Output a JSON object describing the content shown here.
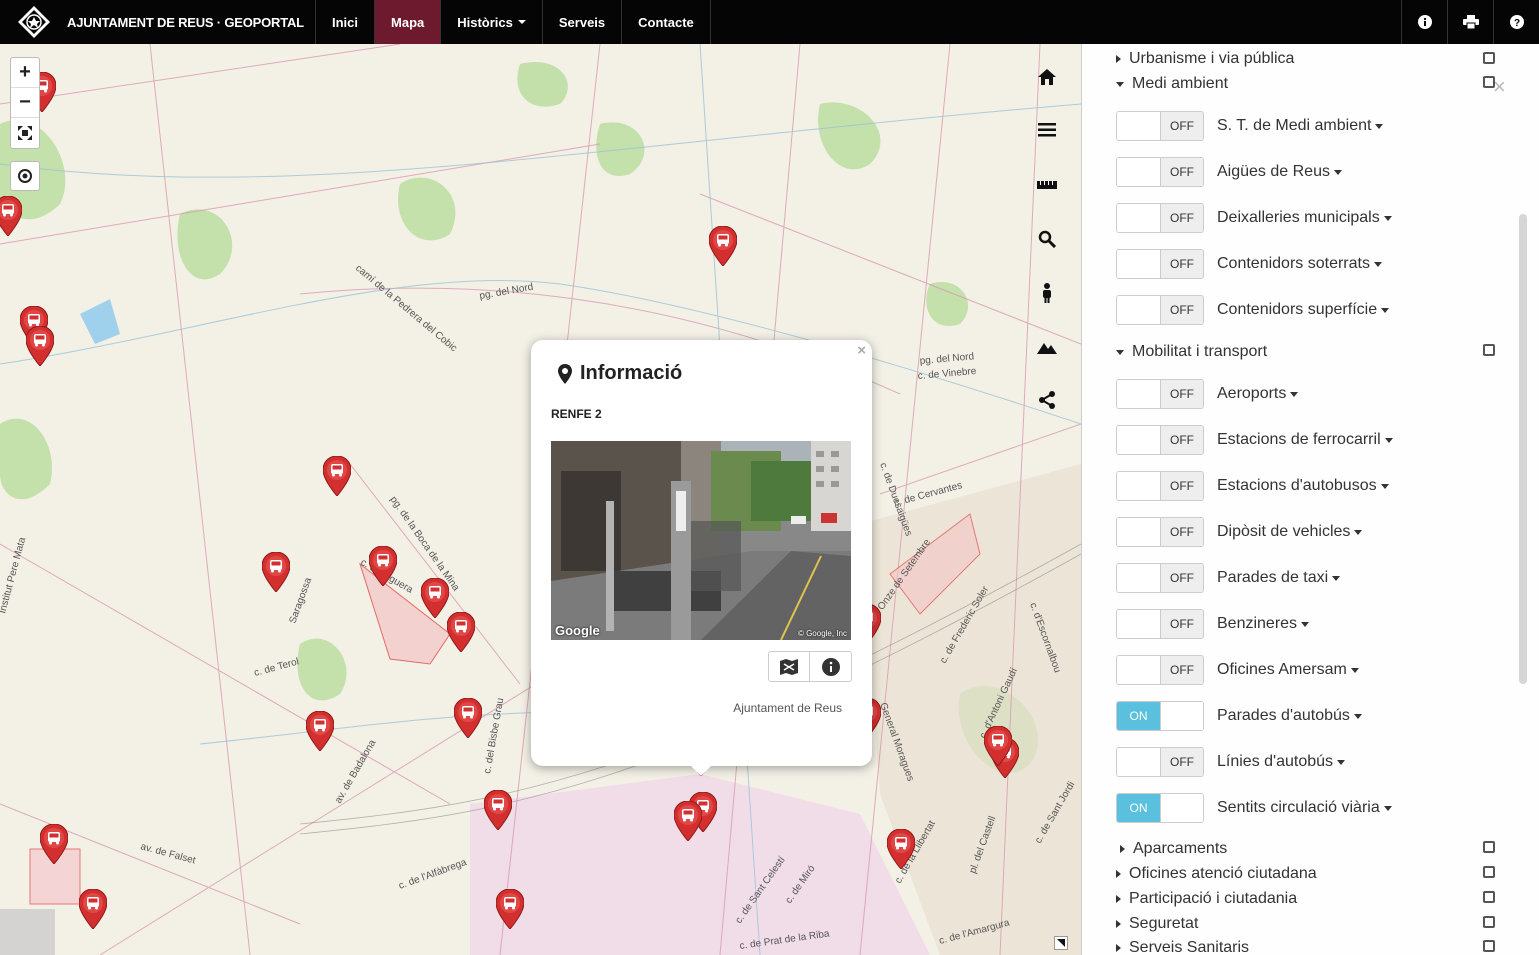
{
  "navbar": {
    "brand": "AJUNTAMENT DE REUS · GEOPORTAL",
    "items": [
      {
        "label": "Inici",
        "active": false
      },
      {
        "label": "Mapa",
        "active": true
      },
      {
        "label": "Històrics",
        "dropdown": true
      },
      {
        "label": "Serveis"
      },
      {
        "label": "Contacte"
      }
    ],
    "right_icons": [
      "info-icon",
      "print-icon",
      "help-icon"
    ]
  },
  "map": {
    "zoom_in": "+",
    "zoom_out": "−",
    "street_labels": [
      "pg. del Nord",
      "camí de la Pedrera del Cobic",
      "pg. de la Boca de la Mina",
      "c. de Figuera",
      "c. de Terol",
      "av. de Badalona",
      "c. del Bisbe Grau",
      "av. de Falset",
      "c. de l'Alfàbrega",
      "c. de Cervantes",
      "l'Onze de Setembre",
      "c. de Frederic Soler",
      "c. d'Antoni Gaudí",
      "General Moragues",
      "c. de la Llibertat",
      "c. de Sant Celestí",
      "c. de Miró",
      "c. de Prat de la Riba",
      "c. de Vinebre",
      "pg. del Nord",
      "Institut Pere Mata",
      "Saragossa",
      "c. de Duesaigües",
      "c. de l'Amargura",
      "c. d'Escornalbou",
      "c. de Sant Jordi",
      "pl. del Castell"
    ]
  },
  "popup": {
    "title": "Informació",
    "subtitle": "RENFE 2",
    "photo_brand": "Google",
    "photo_copyright": "© Google, Inc",
    "footer": "Ajuntament de Reus",
    "close": "×"
  },
  "panel": {
    "close": "×",
    "sections": [
      {
        "label": "Urbanisme i via pública",
        "expanded": false
      },
      {
        "label": "Medi ambient",
        "expanded": true
      },
      {
        "label": "Mobilitat i transport",
        "expanded": true
      },
      {
        "label": "Aparcaments",
        "expanded": false
      },
      {
        "label": "Oficines atenció ciutadana",
        "expanded": false
      },
      {
        "label": "Participació i ciutadania",
        "expanded": false
      },
      {
        "label": "Seguretat",
        "expanded": false
      },
      {
        "label": "Serveis Sanitaris",
        "expanded": false
      }
    ],
    "medi_layers": [
      {
        "label": "S. T. de Medi ambient",
        "state": "OFF"
      },
      {
        "label": "Aigües de Reus",
        "state": "OFF"
      },
      {
        "label": "Deixalleries municipals",
        "state": "OFF"
      },
      {
        "label": "Contenidors soterrats",
        "state": "OFF"
      },
      {
        "label": "Contenidors superfície",
        "state": "OFF"
      }
    ],
    "mobilitat_layers": [
      {
        "label": "Aeroports",
        "state": "OFF"
      },
      {
        "label": "Estacions de ferrocarril",
        "state": "OFF"
      },
      {
        "label": "Estacions d'autobusos",
        "state": "OFF"
      },
      {
        "label": "Dipòsit de vehicles",
        "state": "OFF"
      },
      {
        "label": "Parades de taxi",
        "state": "OFF"
      },
      {
        "label": "Benzineres",
        "state": "OFF"
      },
      {
        "label": "Oficines Amersam",
        "state": "OFF"
      },
      {
        "label": "Parades d'autobús",
        "state": "ON"
      },
      {
        "label": "Línies d'autobús",
        "state": "OFF"
      },
      {
        "label": "Sentits circulació viària",
        "state": "ON"
      }
    ]
  },
  "colors": {
    "navbar": "#050505",
    "active_nav": "#6e1a2e",
    "marker": "#d32f2f",
    "toggle_on": "#5bc0de"
  }
}
